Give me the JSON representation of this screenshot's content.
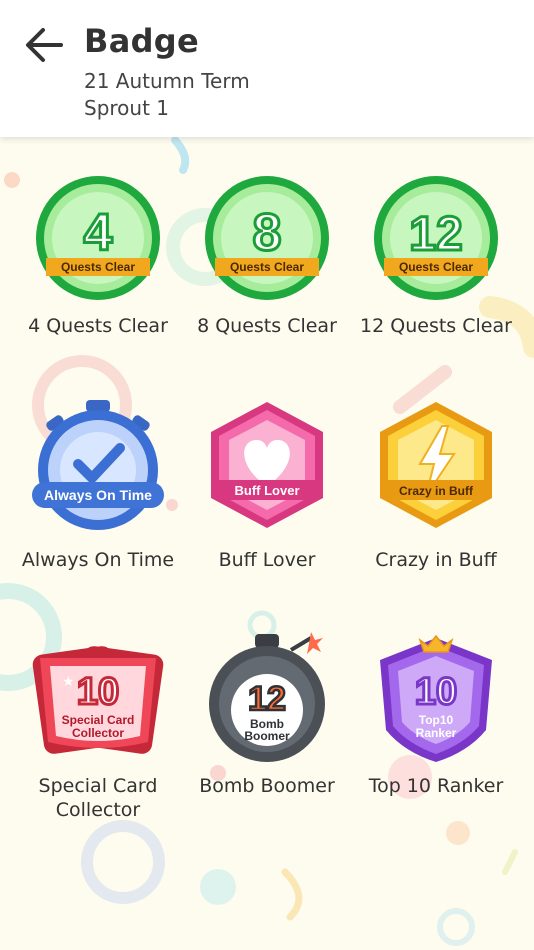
{
  "header": {
    "title": "Badge",
    "term": "21 Autumn Term",
    "class_name": "Sprout 1"
  },
  "badges": [
    {
      "label": "4 Quests Clear",
      "icon_number": "4",
      "icon_text": "Quests Clear",
      "icon": "green-circle-badge"
    },
    {
      "label": "8 Quests Clear",
      "icon_number": "8",
      "icon_text": "Quests Clear",
      "icon": "green-circle-badge"
    },
    {
      "label": "12 Quests Clear",
      "icon_number": "12",
      "icon_text": "Quests Clear",
      "icon": "green-circle-badge"
    },
    {
      "label": "Always On Time",
      "icon_text": "Always On Time",
      "icon": "stopwatch-check-badge"
    },
    {
      "label": "Buff Lover",
      "icon_text": "Buff Lover",
      "icon": "pink-heart-hexagon-badge"
    },
    {
      "label": "Crazy in Buff",
      "icon_text": "Crazy in Buff",
      "icon": "yellow-lightning-hexagon-badge"
    },
    {
      "label": "Special Card\nCollector",
      "icon_number": "10",
      "icon_text1": "Special Card",
      "icon_text2": "Collector",
      "icon": "red-cards-badge"
    },
    {
      "label": "Bomb Boomer",
      "icon_number": "12",
      "icon_text1": "Bomb",
      "icon_text2": "Boomer",
      "icon": "bomb-badge"
    },
    {
      "label": "Top 10 Ranker",
      "icon_number": "10",
      "icon_text1": "Top10",
      "icon_text2": "Ranker",
      "icon": "purple-crown-shield-badge"
    }
  ],
  "colors": {
    "green": "#2ebd4a",
    "pink": "#e9559b",
    "yellow": "#f6b72a",
    "blue": "#3f73d6",
    "red": "#e84456",
    "bomb": "#4b5056",
    "purple": "#8d4ad9"
  }
}
